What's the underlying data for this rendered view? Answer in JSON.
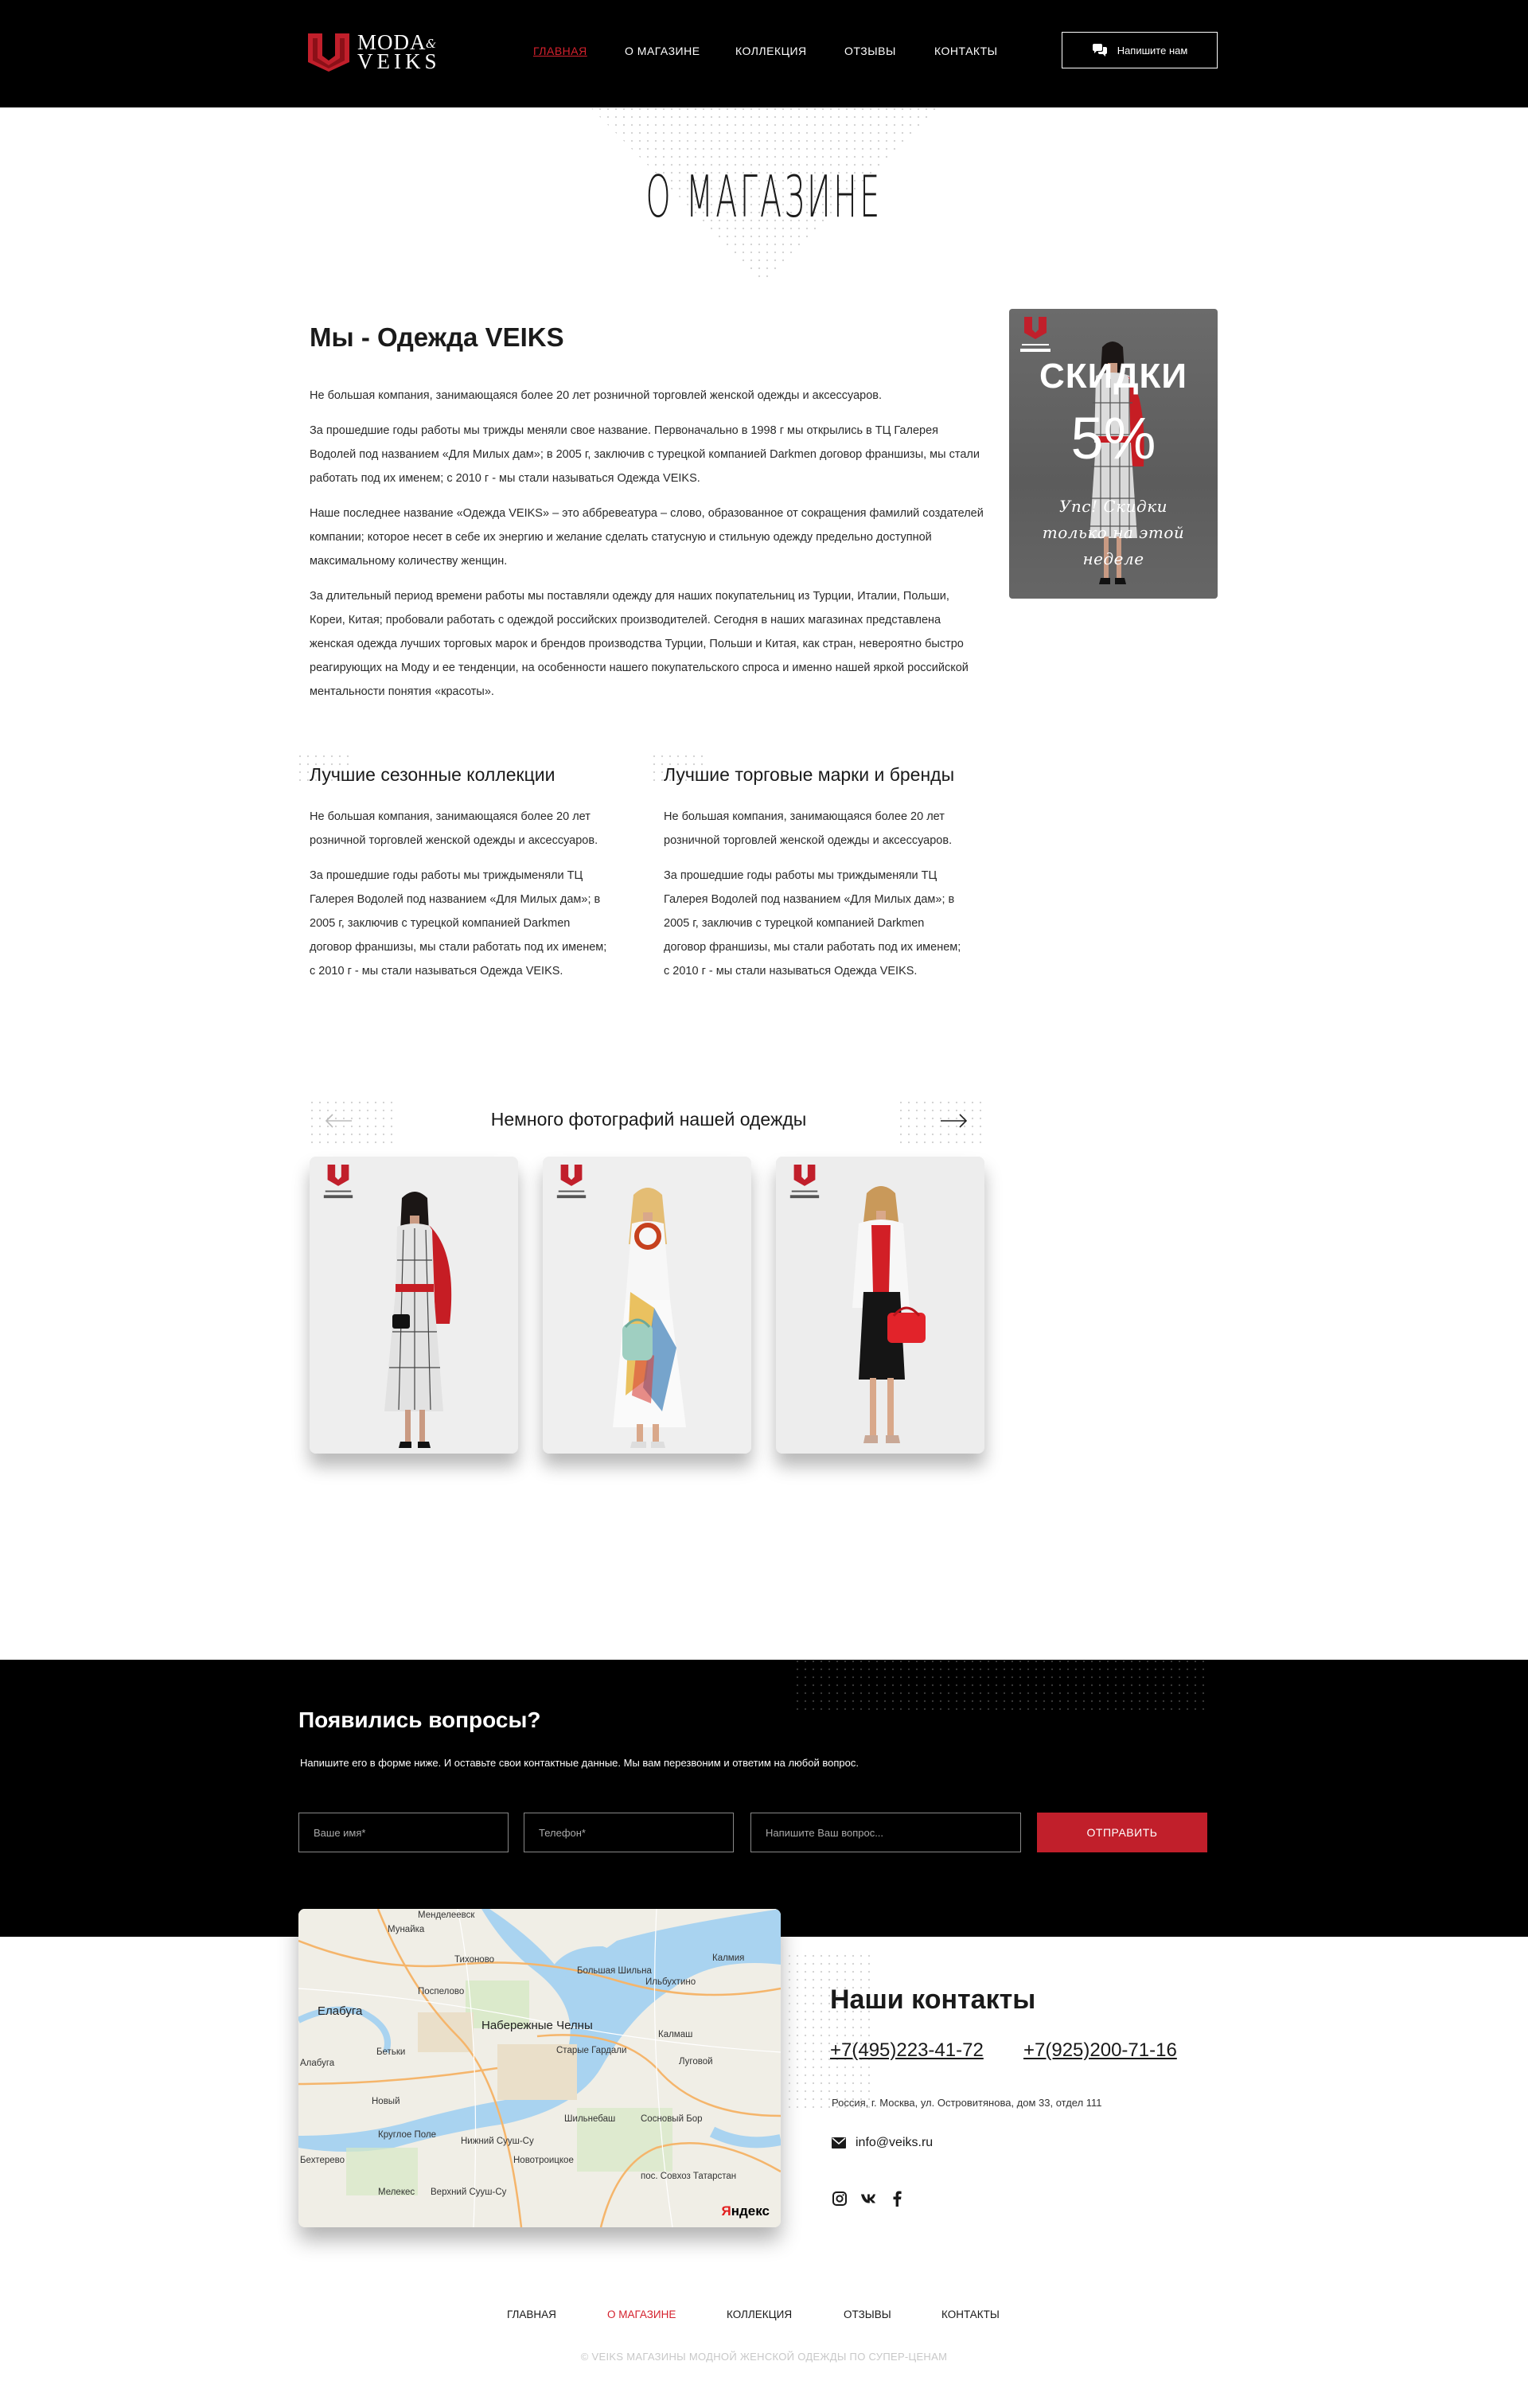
{
  "brand": {
    "logo_top": "MODA",
    "logo_amp": "&",
    "logo_bottom": "VEIKS",
    "accent_color": "#d4212d",
    "logo_icon": "veiks-u-logo-icon"
  },
  "nav": {
    "items": [
      {
        "label": "ГЛАВНАЯ",
        "active": true
      },
      {
        "label": "О МАГАЗИНЕ",
        "active": false
      },
      {
        "label": "КОЛЛЕКЦИЯ",
        "active": false
      },
      {
        "label": "ОТЗЫВЫ",
        "active": false
      },
      {
        "label": "КОНТАКТЫ",
        "active": false
      }
    ],
    "write_button": "Напишите нам",
    "write_icon": "chat-bubbles-icon"
  },
  "page_title": "О МАГАЗИНЕ",
  "about": {
    "title": "Мы - Одежда VEIKS",
    "paragraphs": [
      "Не большая компания, занимающаяся более 20 лет розничной торговлей женской одежды и аксессуаров.",
      "За прошедшие годы работы мы трижды меняли свое название. Первоначально в 1998 г мы открылись в ТЦ Галерея Водолей под названием «Для Милых дам»; в 2005 г, заключив с турецкой компанией Darkmen договор франшизы, мы стали работать под их именем; с 2010 г - мы стали называться Одежда VEIKS.",
      "Наше последнее название «Одежда VEIKS» – это аббревеатура – слово, образованное от сокращения фамилий создателей компании; которое несет в себе их энергию и желание сделать статусную и стильную одежду предельно доступной максимальному количеству женщин.",
      "За длительный период времени работы мы поставляли одежду для наших покупательниц из Турции, Италии, Польши, Кореи, Китая; пробовали работать с одеждой российских производителей. Сегодня в наших магазинах представлена женская одежда лучших торговых марок и брендов производства Турции, Польши и Китая, как стран, невероятно быстро реагирующих на Моду и ее тенденции, на особенности нашего покупательского спроса и именно нашей яркой российской ментальности понятия «красоты»."
    ]
  },
  "promo": {
    "title": "СКИДКИ",
    "percent": "5%",
    "note": "Упс! Скидки только на этой неделе"
  },
  "features": [
    {
      "title": "Лучшие сезонные коллекции",
      "paragraphs": [
        "Не большая компания, занимающаяся более 20 лет розничной торговлей женской одежды и аксессуаров.",
        "За прошедшие годы работы мы триждыменяли ТЦ Галерея Водолей под названием «Для Милых дам»; в 2005 г, заключив с турецкой компанией Darkmen договор франшизы, мы стали работать под их именем; с 2010 г - мы стали называться Одежда VEIKS."
      ]
    },
    {
      "title": "Лучшие торговые марки и бренды",
      "paragraphs": [
        "Не большая компания, занимающаяся более 20 лет розничной торговлей женской одежды и аксессуаров.",
        "За прошедшие годы работы мы триждыменяли ТЦ Галерея Водолей под названием «Для Милых дам»; в 2005 г, заключив с турецкой компанией Darkmen договор франшизы, мы стали работать под их именем; с 2010 г - мы стали называться Одежда VEIKS."
      ]
    }
  ],
  "gallery": {
    "title": "Немного фотографий нашей одежды",
    "prev_icon": "arrow-left-icon",
    "next_icon": "arrow-right-icon",
    "photos": [
      {
        "subject": "woman-checked-dress-red-jacket"
      },
      {
        "subject": "woman-printed-long-dress-mint-bag"
      },
      {
        "subject": "woman-white-blazer-red-bag"
      }
    ]
  },
  "question": {
    "title": "Появились вопросы?",
    "subtitle": "Напишите его в форме ниже. И оставьте свои контактные данные. Мы вам перезвоним и ответим на любой вопрос.",
    "name_placeholder": "Ваше имя*",
    "phone_placeholder": "Телефон*",
    "question_placeholder": "Напишите Ваш вопрос...",
    "submit": "ОТПРАВИТЬ",
    "submit_color": "#c11f2b"
  },
  "map": {
    "labels": [
      "Менделеевск",
      "Мунайка",
      "Тихоново",
      "Большая Шильна",
      "Калмия",
      "Елабуга",
      "Поспелово",
      "Набережные Челны",
      "Ильбухтино",
      "Старые Гардали",
      "Калмаш",
      "Луговой",
      "Новый",
      "Бетьки",
      "Круглое Поле",
      "Нижний Сууш-Су",
      "Шильнебаш",
      "Сосновый Бор",
      "Новотроицкое",
      "Мелекес",
      "Верхний Сууш-Су",
      "пос. Совхоз Татарстан",
      "Бехтерево",
      "Алабуга"
    ],
    "logo_prefix": "Я",
    "logo_rest": "ндекс"
  },
  "contacts": {
    "title": "Наши контакты",
    "phone1": "+7(495)223-41-72",
    "phone2": "+7(925)200-71-16",
    "address": "Россия, г. Москва, ул. Островитянова, дом 33, отдел 111",
    "email": "info@veiks.ru",
    "email_icon": "envelope-icon",
    "socials": [
      "instagram-icon",
      "vk-icon",
      "facebook-icon"
    ]
  },
  "footer": {
    "nav": [
      {
        "label": "ГЛАВНАЯ",
        "active": false
      },
      {
        "label": "О МАГАЗИНЕ",
        "active": true
      },
      {
        "label": "КОЛЛЕКЦИЯ",
        "active": false
      },
      {
        "label": "ОТЗЫВЫ",
        "active": false
      },
      {
        "label": "КОНТАКТЫ",
        "active": false
      }
    ],
    "copyright": "© VEIKS МАГАЗИНЫ МОДНОЙ ЖЕНСКОЙ ОДЕЖДЫ ПО СУПЕР-ЦЕНАМ"
  }
}
